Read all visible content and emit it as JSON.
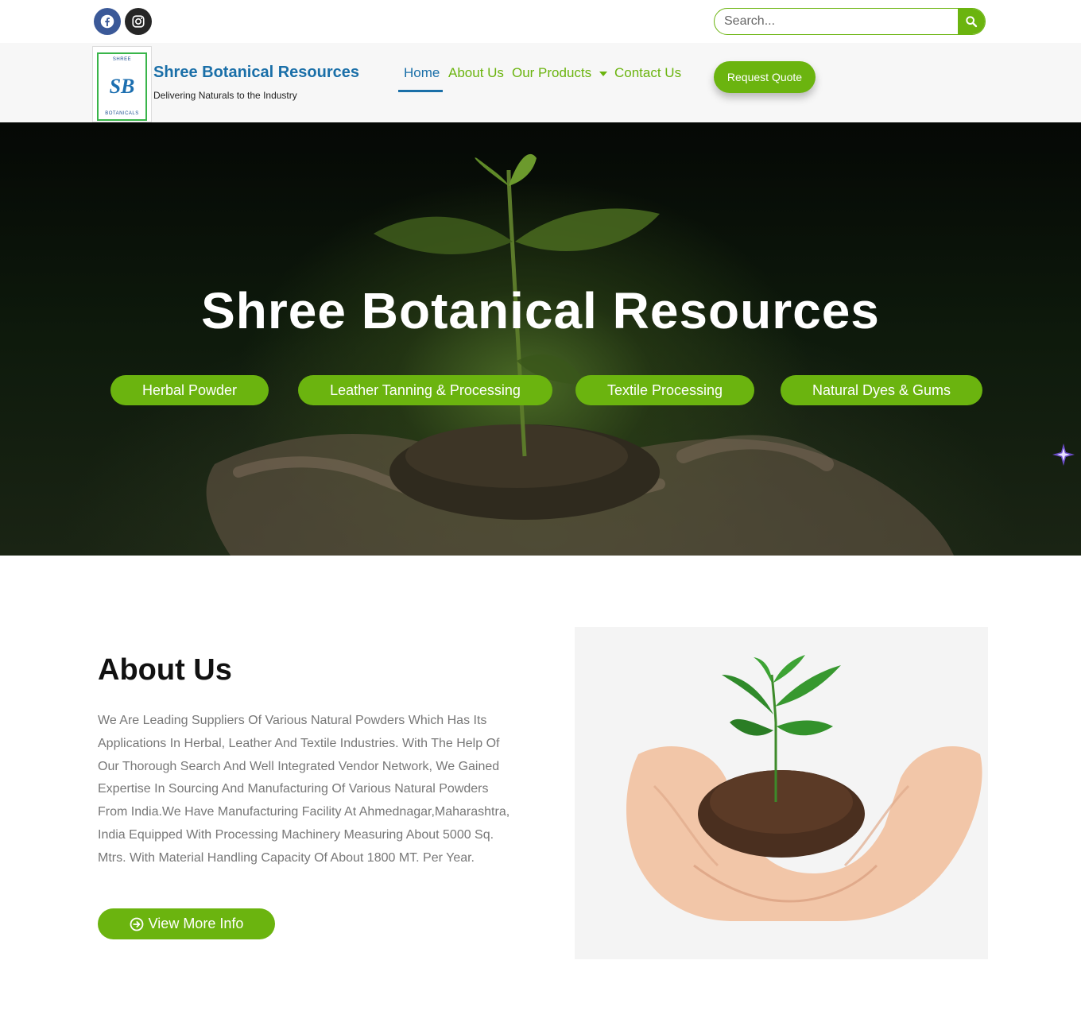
{
  "topbar": {
    "social": [
      {
        "icon": "facebook-icon"
      },
      {
        "icon": "instagram-icon"
      }
    ],
    "search": {
      "placeholder": "Search...",
      "icon": "search-icon"
    }
  },
  "header": {
    "logo": {
      "top_text": "SHREE",
      "mark": "SB",
      "bottom_text": "BOTANICALS"
    },
    "brand_name": "Shree Botanical Resources",
    "tagline": "Delivering Naturals to the Industry",
    "nav": {
      "home": "Home",
      "about": "About Us",
      "products": "Our Products",
      "contact": "Contact Us"
    },
    "quote_button": "Request Quote"
  },
  "hero": {
    "title": "Shree Botanical Resources",
    "pills": [
      "Herbal Powder",
      "Leather Tanning & Processing",
      "Textile Processing",
      "Natural Dyes & Gums"
    ]
  },
  "about": {
    "title": "About Us",
    "text": "We Are Leading Suppliers Of Various Natural Powders Which Has Its Applications In Herbal, Leather And Textile Industries. With The Help Of Our Thorough Search And Well Integrated Vendor Network, We Gained Expertise In Sourcing And Manufacturing Of Various Natural Powders From India.We Have Manufacturing Facility At Ahmednagar,Maharashtra, India Equipped With Processing Machinery Measuring About 5000 Sq. Mtrs. With Material Handling Capacity Of About 1800 MT. Per Year.",
    "button": "View More Info"
  },
  "colors": {
    "accent_green": "#6bb40f",
    "brand_blue": "#1a6fa8",
    "facebook": "#3b5998"
  }
}
